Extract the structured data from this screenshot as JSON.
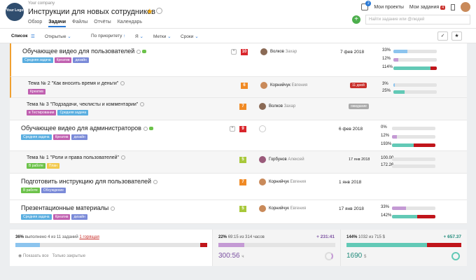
{
  "header": {
    "logo_text": "Your Logo",
    "company": "Your company",
    "title": "Инструкции для новых сотрудников",
    "tabs": [
      "Обзор",
      "Задачи",
      "Файлы",
      "Отчёты",
      "Календарь"
    ],
    "active_tab": "Задачи",
    "notifications_count": "2",
    "my_projects": "Мои проекты",
    "my_tasks": "Мои задания",
    "my_tasks_count": "4",
    "search_placeholder": "Найти задание или @людей"
  },
  "toolbar": {
    "view": "Список",
    "filter_open": "Открытые",
    "sort": "По приоритету",
    "me": "Я",
    "labels": "Метки",
    "deadlines": "Сроки"
  },
  "tasks": [
    {
      "name": "Обучающее видео для пользователей",
      "tags": [
        {
          "t": "Средняя задача",
          "c": "#5aaee0"
        },
        {
          "t": "Креатив",
          "c": "#c060b0"
        },
        {
          "t": "дизайн",
          "c": "#7a8ad8"
        }
      ],
      "prio": "10",
      "prio_color": "#d9262c",
      "person": "Волков",
      "person2": "Захар",
      "date": "7 фев 2018",
      "progress": [
        {
          "pct": "33%",
          "fill": 0.33,
          "color": "#8cc4ee",
          "over": 0
        },
        {
          "pct": "12%",
          "fill": 0.12,
          "color": "#c49ad4",
          "over": 0
        },
        {
          "pct": "114%",
          "fill": 1.0,
          "color": "#62c9b6",
          "over": 0.14
        }
      ]
    },
    {
      "name": "Тема № 2 \"Как вносить время и деньги\"",
      "tags": [
        {
          "t": "Креатив",
          "c": "#c060b0"
        }
      ],
      "prio": "6",
      "prio_color": "#f08a24",
      "person": "Корнийчук",
      "person2": "Евгения",
      "status": "11 дней",
      "status_color": "#c9302c",
      "progress": [
        {
          "pct": "3%",
          "fill": 0.03,
          "color": "#8cc4ee",
          "over": 0
        },
        {
          "pct": "25%",
          "fill": 0.25,
          "color": "#62c9b6",
          "over": 0
        }
      ]
    },
    {
      "name": "Тема № 3 \"Подзадачи, чеклисты и комментарии\"",
      "tags": [
        {
          "t": "в Тестировании",
          "c": "#c060b0"
        },
        {
          "t": "Средняя задача",
          "c": "#5aaee0"
        }
      ],
      "prio": "7",
      "prio_color": "#f08a24",
      "person": "Волков",
      "person2": "Захар",
      "status": "ожидание",
      "status_color": "#aaaaaa",
      "progress": []
    },
    {
      "name": "Обучающее видео для администраторов",
      "tags": [
        {
          "t": "Средняя задача",
          "c": "#5aaee0"
        },
        {
          "t": "Креатив",
          "c": "#c060b0"
        },
        {
          "t": "дизайн",
          "c": "#7a8ad8"
        }
      ],
      "prio": "9",
      "prio_color": "#d9262c",
      "person": "",
      "person2": "",
      "date": "6 фев 2018",
      "progress": [
        {
          "pct": "0%",
          "fill": 0,
          "color": "#8cc4ee",
          "over": 0
        },
        {
          "pct": "12%",
          "fill": 0.12,
          "color": "#c49ad4",
          "over": 0
        },
        {
          "pct": "193%",
          "fill": 1.0,
          "color": "#62c9b6",
          "over": 0.5
        }
      ]
    },
    {
      "name": "Тема № 1 \"Роли и права пользователей\"",
      "tags": [
        {
          "t": "В работе",
          "c": "#6cc24a"
        },
        {
          "t": "План",
          "c": "#f2c94c"
        }
      ],
      "prio": "5",
      "prio_color": "#a8c83a",
      "person": "Горбунов",
      "person2": "Алексей",
      "date": "17 янв 2018",
      "progress": [
        {
          "pct": "100.00",
          "fill": 0,
          "color": "#8cc4ee",
          "over": 0
        },
        {
          "pct": "172.26",
          "fill": 0,
          "color": "#62c9b6",
          "over": 0
        }
      ]
    },
    {
      "name": "Подготовить инструкцию для пользователей",
      "tags": [
        {
          "t": "В работе",
          "c": "#6cc24a"
        },
        {
          "t": "Обсуждение",
          "c": "#7a8ad8"
        }
      ],
      "prio": "7",
      "prio_color": "#f08a24",
      "person": "Корнийчук",
      "person2": "Евгения",
      "date": "1 янв 2018",
      "progress": []
    },
    {
      "name": "Презентационные материалы",
      "tags": [
        {
          "t": "Средняя задача",
          "c": "#5aaee0"
        },
        {
          "t": "Креатив",
          "c": "#c060b0"
        },
        {
          "t": "дизайн",
          "c": "#7a8ad8"
        }
      ],
      "prio": "5",
      "prio_color": "#a8c83a",
      "person": "Корнийчук",
      "person2": "Евгения",
      "date": "17 янв 2018",
      "progress": [
        {
          "pct": "33%",
          "fill": 0.33,
          "color": "#c49ad4",
          "over": 0
        },
        {
          "pct": "142%",
          "fill": 1.0,
          "color": "#62c9b6",
          "over": 0.42
        }
      ]
    }
  ],
  "footer": {
    "tasks_pct": "36%",
    "tasks_text": "выполнено 4 из 11 заданий",
    "tasks_overdue": "1 горящая",
    "tasks_fill": 0.36,
    "show_all": "Показать все",
    "only_closed": "Только закрытые",
    "hours_pct": "22%",
    "hours_text": "69:15 из 314 часов",
    "hours_delta": "+ 231:41",
    "hours_big": "300:56",
    "hours_unit": "ч",
    "hours_fill": 0.22,
    "money_pct": "144%",
    "money_text": "1032 из 715 $",
    "money_delta": "+ 657.37",
    "money_big": "1690",
    "money_unit": "$",
    "money_fill": 0.7
  }
}
